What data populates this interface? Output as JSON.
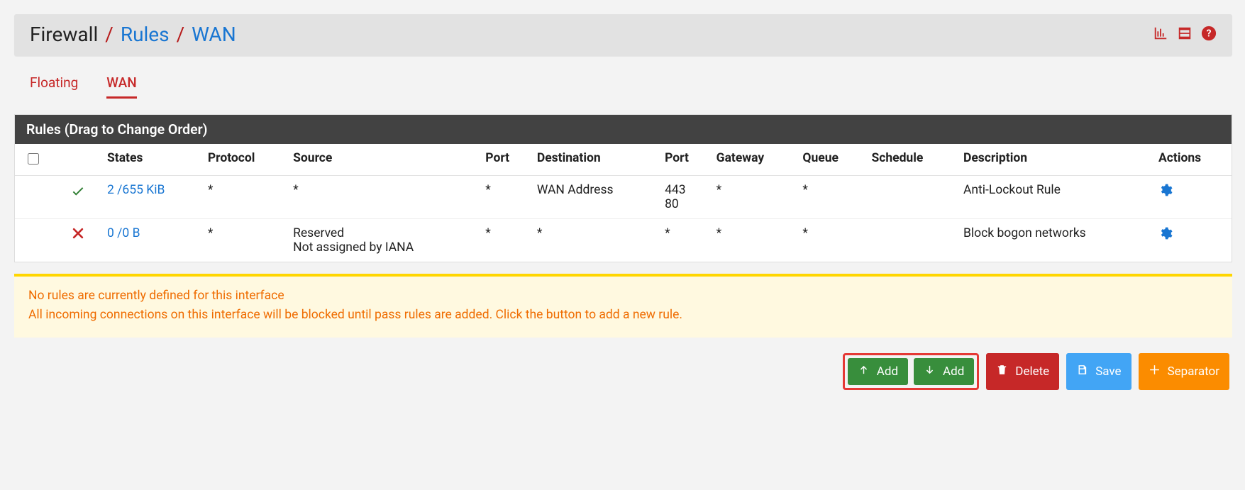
{
  "breadcrumb": {
    "root": "Firewall",
    "rules": "Rules",
    "wan": "WAN"
  },
  "tabs": {
    "items": [
      "Floating",
      "WAN"
    ],
    "active_index": 1
  },
  "panel": {
    "title": "Rules (Drag to Change Order)",
    "columns": {
      "states": "States",
      "protocol": "Protocol",
      "source": "Source",
      "port_src": "Port",
      "destination": "Destination",
      "port_dst": "Port",
      "gateway": "Gateway",
      "queue": "Queue",
      "schedule": "Schedule",
      "description": "Description",
      "actions": "Actions"
    }
  },
  "rules": [
    {
      "status": "pass",
      "states": "2 /655 KiB",
      "protocol": "*",
      "source": "*",
      "port_src": "*",
      "destination": "WAN Address",
      "port_dst": "443\n80",
      "gateway": "*",
      "queue": "*",
      "schedule": "",
      "description": "Anti-Lockout Rule"
    },
    {
      "status": "block",
      "states": "0 /0 B",
      "protocol": "*",
      "source": "Reserved\nNot assigned by IANA",
      "port_src": "*",
      "destination": "*",
      "port_dst": "*",
      "gateway": "*",
      "queue": "*",
      "schedule": "",
      "description": "Block bogon networks"
    }
  ],
  "info": {
    "line1": "No rules are currently defined for this interface",
    "line2": "All incoming connections on this interface will be blocked until pass rules are added. Click the button to add a new rule."
  },
  "buttons": {
    "add_top": "Add",
    "add_bottom": "Add",
    "delete": "Delete",
    "save": "Save",
    "separator": "Separator"
  }
}
